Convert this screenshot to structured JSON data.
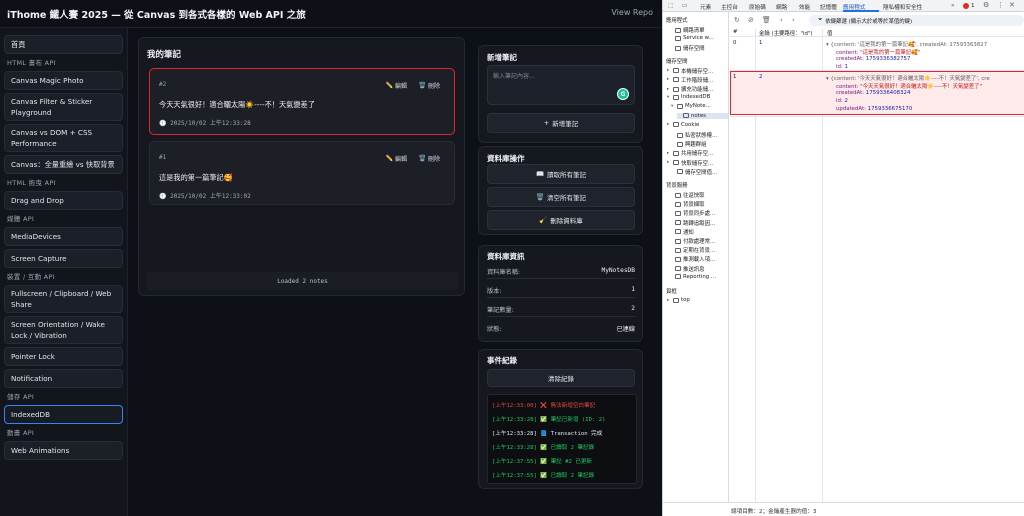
{
  "app": {
    "title": "iThome 鐵人賽 2025 — 從 Canvas 到各式各樣的 Web API 之旅",
    "view_repo": "View Repo"
  },
  "sidebar": {
    "home": "首頁",
    "groups": [
      {
        "head": "HTML 畫布 API",
        "items": [
          "Canvas Magic Photo",
          "Canvas Filter & Sticker Playground",
          "Canvas vs DOM + CSS Performance",
          "Canvas：全量重繪 vs 快取背景"
        ]
      },
      {
        "head": "HTML 拖曳 API",
        "items": [
          "Drag and Drop"
        ]
      },
      {
        "head": "媒體 API",
        "items": [
          "MediaDevices",
          "Screen Capture"
        ]
      },
      {
        "head": "裝置 / 互動 API",
        "items": [
          "Fullscreen / Clipboard / Web Share",
          "Screen Orientation / Wake Lock / Vibration",
          "Pointer Lock",
          "Notification"
        ]
      },
      {
        "head": "儲存 API",
        "items": [
          "IndexedDB"
        ]
      },
      {
        "head": "動畫 API",
        "items": [
          "Web Animations"
        ]
      }
    ],
    "active": "IndexedDB"
  },
  "notes": {
    "title": "我的筆記",
    "edit_label": "編輯",
    "delete_label": "刪除",
    "items": [
      {
        "id": "#2",
        "text": "今天天氣很好！適合曬太陽☀️----不！天氣變差了",
        "time": "2025/10/02 上午12:33:28"
      },
      {
        "id": "#1",
        "text": "這是我的第一篇筆記🥰",
        "time": "2025/10/02 上午12:33:02"
      }
    ],
    "status": "Loaded 2 notes"
  },
  "add_note": {
    "title": "新增筆記",
    "placeholder": "輸入筆記內容...",
    "button": "新增筆記"
  },
  "db_ops": {
    "title": "資料庫操作",
    "read_all": "讀取所有筆記",
    "clear_all": "清空所有筆記",
    "delete_db": "刪除資料庫"
  },
  "db_info": {
    "title": "資料庫資訊",
    "rows": [
      {
        "label": "資料庫名稱:",
        "value": "MyNotesDB"
      },
      {
        "label": "版本:",
        "value": "1"
      },
      {
        "label": "筆記數量:",
        "value": "2"
      },
      {
        "label": "狀態:",
        "value": "已連線"
      }
    ]
  },
  "events": {
    "title": "事件紀錄",
    "clear": "清除紀錄",
    "log": [
      {
        "time": "[上午12:33:00]",
        "icon": "❌",
        "text": "無法新增空白筆記",
        "color": "#ef4444"
      },
      {
        "time": "[上午12:33:28]",
        "icon": "✅",
        "text": "筆記已新增 (ID: 2)",
        "color": "#22c55e"
      },
      {
        "time": "[上午12:33:28]",
        "icon": "📘",
        "text": "Transaction 完成",
        "color": "#e6e9ef"
      },
      {
        "time": "[上午12:33:28]",
        "icon": "✅",
        "text": "已讀取 2 筆記錄",
        "color": "#22c55e"
      },
      {
        "time": "[上午12:37:55]",
        "icon": "✅",
        "text": "筆記 #2 已更新",
        "color": "#22c55e"
      },
      {
        "time": "[上午12:37:55]",
        "icon": "✅",
        "text": "已讀取 2 筆記錄",
        "color": "#22c55e"
      }
    ]
  },
  "devtools": {
    "tabs": [
      "元素",
      "主控台",
      "原始碼",
      "網路",
      "效能",
      "記憶體",
      "應用程式",
      "隱私權和安全性"
    ],
    "active_tab": "應用程式",
    "error_count": "1",
    "left": {
      "app_head": "應用程式",
      "app_items": [
        "網路清單",
        "Service w...",
        "儲存空間"
      ],
      "storage_head": "儲存空間",
      "storage_items": [
        "本機儲存空...",
        "工作階段儲...",
        "擴充功能儲...",
        "IndexedDB",
        "MyNote...",
        "notes",
        "Cookie",
        "私密狀態權...",
        "興趣群組",
        "共用儲存空...",
        "快取儲存空...",
        "儲存空間值..."
      ],
      "bg_head": "背景服務",
      "bg_items": [
        "往返快取",
        "背景擷取",
        "背景同步處...",
        "跳轉追蹤因...",
        "通知",
        "付款處理常...",
        "定期在背景...",
        "推測載入項...",
        "推送訊息",
        "Reporting ..."
      ],
      "frames_head": "頁框",
      "frames_items": [
        "top"
      ]
    },
    "filter_label": "依鍵篩選 (顯示大於或等於某值的鍵)",
    "columns": [
      "#",
      "金鑰 (主要路徑：\"id\")",
      "值"
    ],
    "rows": [
      {
        "index": "0",
        "key": "1",
        "summary": "{content: '這是我的第一篇筆記🥰', createdAt: 17593363827",
        "fields": [
          {
            "k": "content:",
            "v": "\"這是我的第一篇筆記🥰\"",
            "t": "str"
          },
          {
            "k": "createdAt:",
            "v": "1759336382757",
            "t": "num"
          },
          {
            "k": "id:",
            "v": "1",
            "t": "num"
          }
        ]
      },
      {
        "index": "1",
        "key": "2",
        "summary": "{content: '今天天氣很好！適合曬太陽☀️----不！天氣變差了', cre",
        "fields": [
          {
            "k": "content:",
            "v": "\"今天天氣很好！適合曬太陽☀️----不！天氣變差了\"",
            "t": "str"
          },
          {
            "k": "createdAt:",
            "v": "1759336408324",
            "t": "num"
          },
          {
            "k": "id:",
            "v": "2",
            "t": "num"
          },
          {
            "k": "updatedAt:",
            "v": "1759336675170",
            "t": "num"
          }
        ]
      }
    ],
    "footer": "總項目數：2；金鑰產生器的值：3"
  }
}
